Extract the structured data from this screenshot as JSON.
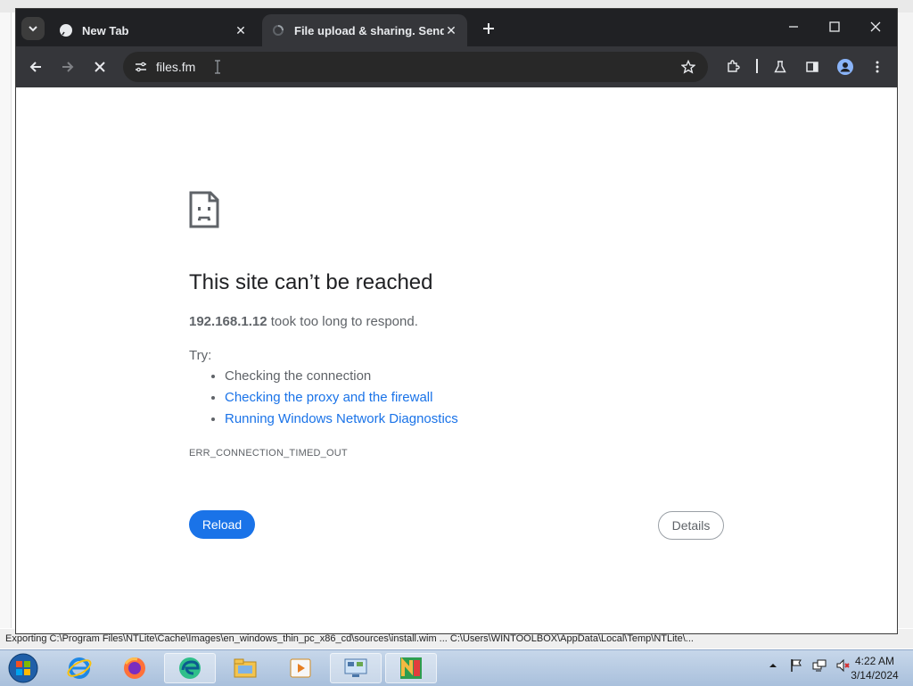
{
  "window_title": "NTLite",
  "tabs": [
    {
      "label": "New Tab",
      "active": false
    },
    {
      "label": "File upload & sharing. Send lar",
      "active": true
    }
  ],
  "toolbar": {
    "url": "files.fm"
  },
  "error_page": {
    "title": "This site can’t be reached",
    "host": "192.168.1.12",
    "desc_rest": " took too long to respond.",
    "try_label": "Try:",
    "suggestions": [
      "Checking the connection",
      "Checking the proxy and the firewall",
      "Running Windows Network Diagnostics"
    ],
    "error_code": "ERR_CONNECTION_TIMED_OUT",
    "reload_label": "Reload",
    "details_label": "Details"
  },
  "background_status": "Exporting C:\\Program Files\\NTLite\\Cache\\Images\\en_windows_thin_pc_x86_cd\\sources\\install.wim ... C:\\Users\\WINTOOLBOX\\AppData\\Local\\Temp\\NTLite\\...",
  "taskbar": {
    "icons": [
      "internet-explorer-icon",
      "firefox-icon",
      "edge-icon",
      "explorer-icon",
      "media-player-icon",
      "control-panel-icon",
      "ntlite-icon"
    ],
    "time": "4:22 AM",
    "date": "3/14/2024"
  },
  "colors": {
    "accent": "#1a73e8",
    "browser_frame": "#202124",
    "toolbar": "#35363a",
    "text_secondary": "#5f6368"
  }
}
